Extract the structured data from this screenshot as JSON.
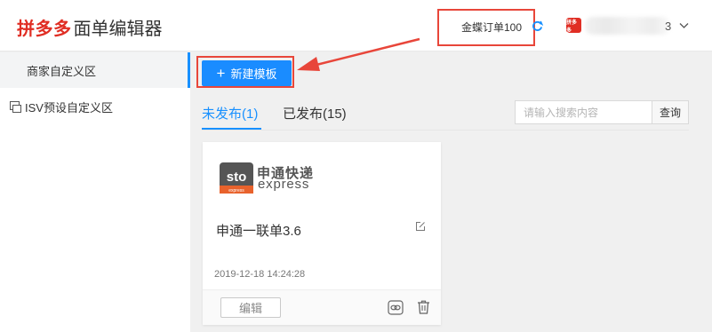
{
  "header": {
    "logo_brand": "拼多多",
    "logo_sub": "面单编辑器",
    "shop_name": "金蝶订单100",
    "user_suffix": "3",
    "pdd_badge": "拼多多",
    "icons": {
      "refresh": "refresh-icon",
      "dropdown": "chevron-down-icon"
    }
  },
  "sidebar": {
    "items": [
      {
        "label": "商家自定义区",
        "icon": "grid-icon",
        "active": true
      },
      {
        "label": "ISV预设自定义区",
        "icon": "window-icon",
        "active": false
      }
    ]
  },
  "toolbar": {
    "new_template_label": "新建模板",
    "plus": "+"
  },
  "tabs": [
    {
      "label": "未发布(1)",
      "active": true
    },
    {
      "label": "已发布(15)",
      "active": false
    }
  ],
  "search": {
    "placeholder": "请输入搜索内容",
    "button_label": "查询"
  },
  "cards": [
    {
      "courier_cn": "申通快递",
      "courier_en": "express",
      "logo_text": "sto",
      "logo_sub": "express",
      "name": "申通一联单3.6",
      "date": "2019-12-18 14:24:28",
      "edit_label": "编辑"
    }
  ],
  "colors": {
    "brand_red": "#e02e24",
    "accent_blue": "#1890ff",
    "button_blue": "#1a8cff",
    "highlight_red": "#e8463a"
  }
}
